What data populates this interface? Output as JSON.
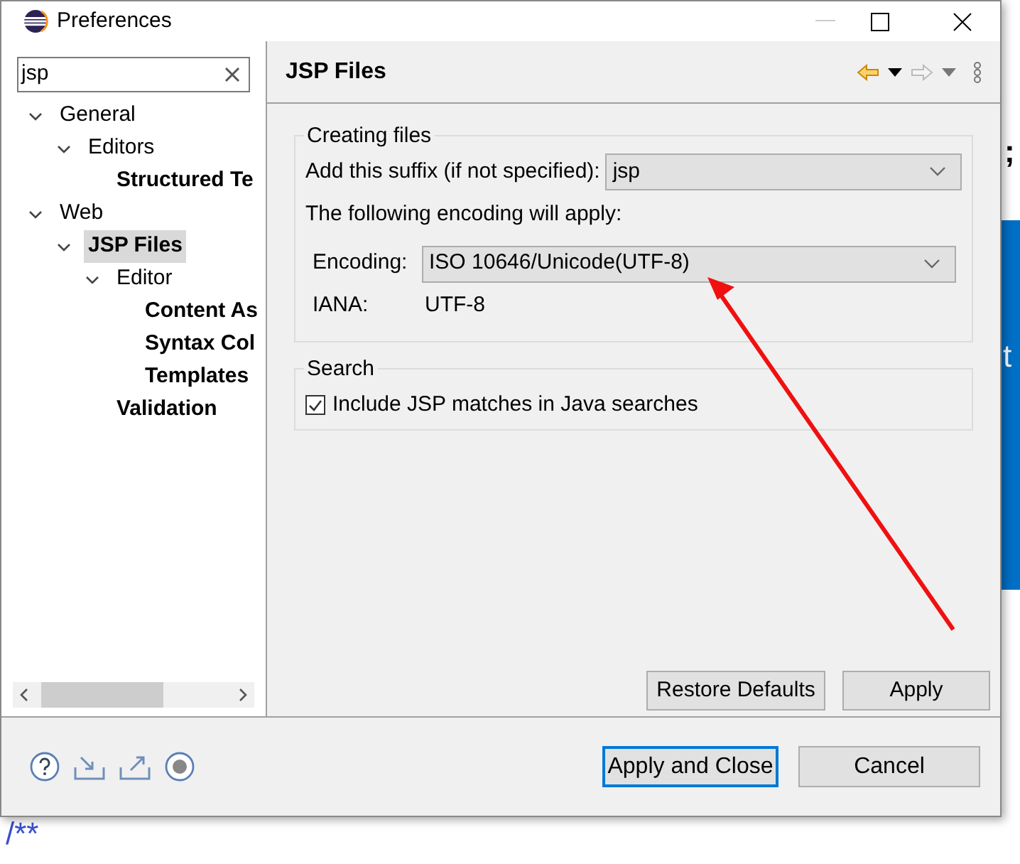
{
  "window": {
    "title": "Preferences"
  },
  "filter": {
    "value": "jsp"
  },
  "tree": [
    {
      "label": "General",
      "selected": false,
      "matched": false,
      "expanded": true,
      "children": [
        {
          "label": "Editors",
          "selected": false,
          "matched": false,
          "expanded": true,
          "children": [
            {
              "label": "Structured Te",
              "selected": false,
              "matched": true
            }
          ]
        }
      ]
    },
    {
      "label": "Web",
      "selected": false,
      "matched": false,
      "expanded": true,
      "children": [
        {
          "label": "JSP Files",
          "selected": true,
          "matched": true,
          "expanded": true,
          "children": [
            {
              "label": "Editor",
              "selected": false,
              "matched": false,
              "expanded": true,
              "children": [
                {
                  "label": "Content As",
                  "selected": false,
                  "matched": true
                },
                {
                  "label": "Syntax Col",
                  "selected": false,
                  "matched": true
                },
                {
                  "label": "Templates",
                  "selected": false,
                  "matched": true
                }
              ]
            },
            {
              "label": "Validation",
              "selected": false,
              "matched": true
            }
          ]
        }
      ]
    }
  ],
  "page": {
    "title": "JSP Files",
    "creating_files": {
      "legend": "Creating files",
      "suffix_label": "Add this suffix (if not specified):",
      "suffix_value": "jsp",
      "encoding_note": "The following encoding will apply:",
      "encoding_label": "Encoding:",
      "encoding_value": "ISO 10646/Unicode(UTF-8)",
      "iana_label": "IANA:",
      "iana_value": "UTF-8"
    },
    "search": {
      "legend": "Search",
      "option": {
        "label": "Include JSP matches in Java searches",
        "checked": true
      }
    },
    "buttons": [
      "Restore Defaults",
      "Apply"
    ]
  },
  "footer_buttons": [
    {
      "label": "Apply and Close",
      "selected": true
    },
    {
      "label": "Cancel",
      "selected": false
    }
  ],
  "background": {
    "texts": [
      ";",
      "t",
      "/**"
    ]
  }
}
